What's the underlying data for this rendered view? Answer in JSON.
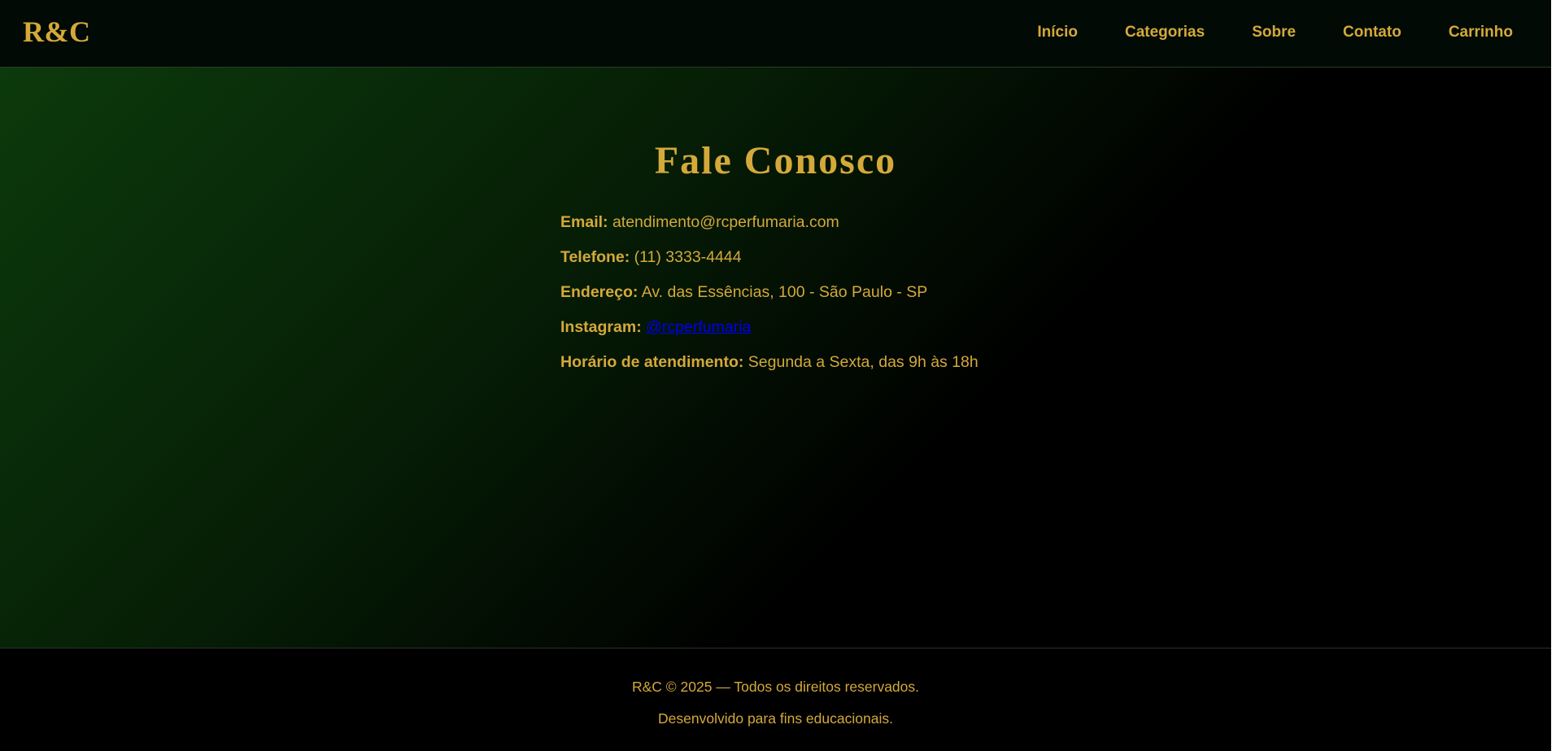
{
  "header": {
    "logo": "R&C",
    "nav": [
      "Início",
      "Categorias",
      "Sobre",
      "Contato",
      "Carrinho"
    ]
  },
  "contact": {
    "title": "Fale Conosco",
    "email": {
      "label": "Email:",
      "value": "atendimento@rcperfumaria.com"
    },
    "phone": {
      "label": "Telefone:",
      "value": "(11) 3333-4444"
    },
    "address": {
      "label": "Endereço:",
      "value": "Av. das Essências, 100 - São Paulo - SP"
    },
    "instagram": {
      "label": "Instagram:",
      "value": "@rcperfumaria"
    },
    "hours": {
      "label": "Horário de atendimento:",
      "value": "Segunda a Sexta, das 9h às 18h"
    }
  },
  "footer": {
    "copyright": "R&C © 2025 — Todos os direitos reservados.",
    "note": "Desenvolvido para fins educacionais."
  },
  "colors": {
    "accent_gold": "#d4a93a",
    "link_blue": "#0000ee",
    "gradient_green": "#0c3a0c",
    "background": "#000000"
  }
}
